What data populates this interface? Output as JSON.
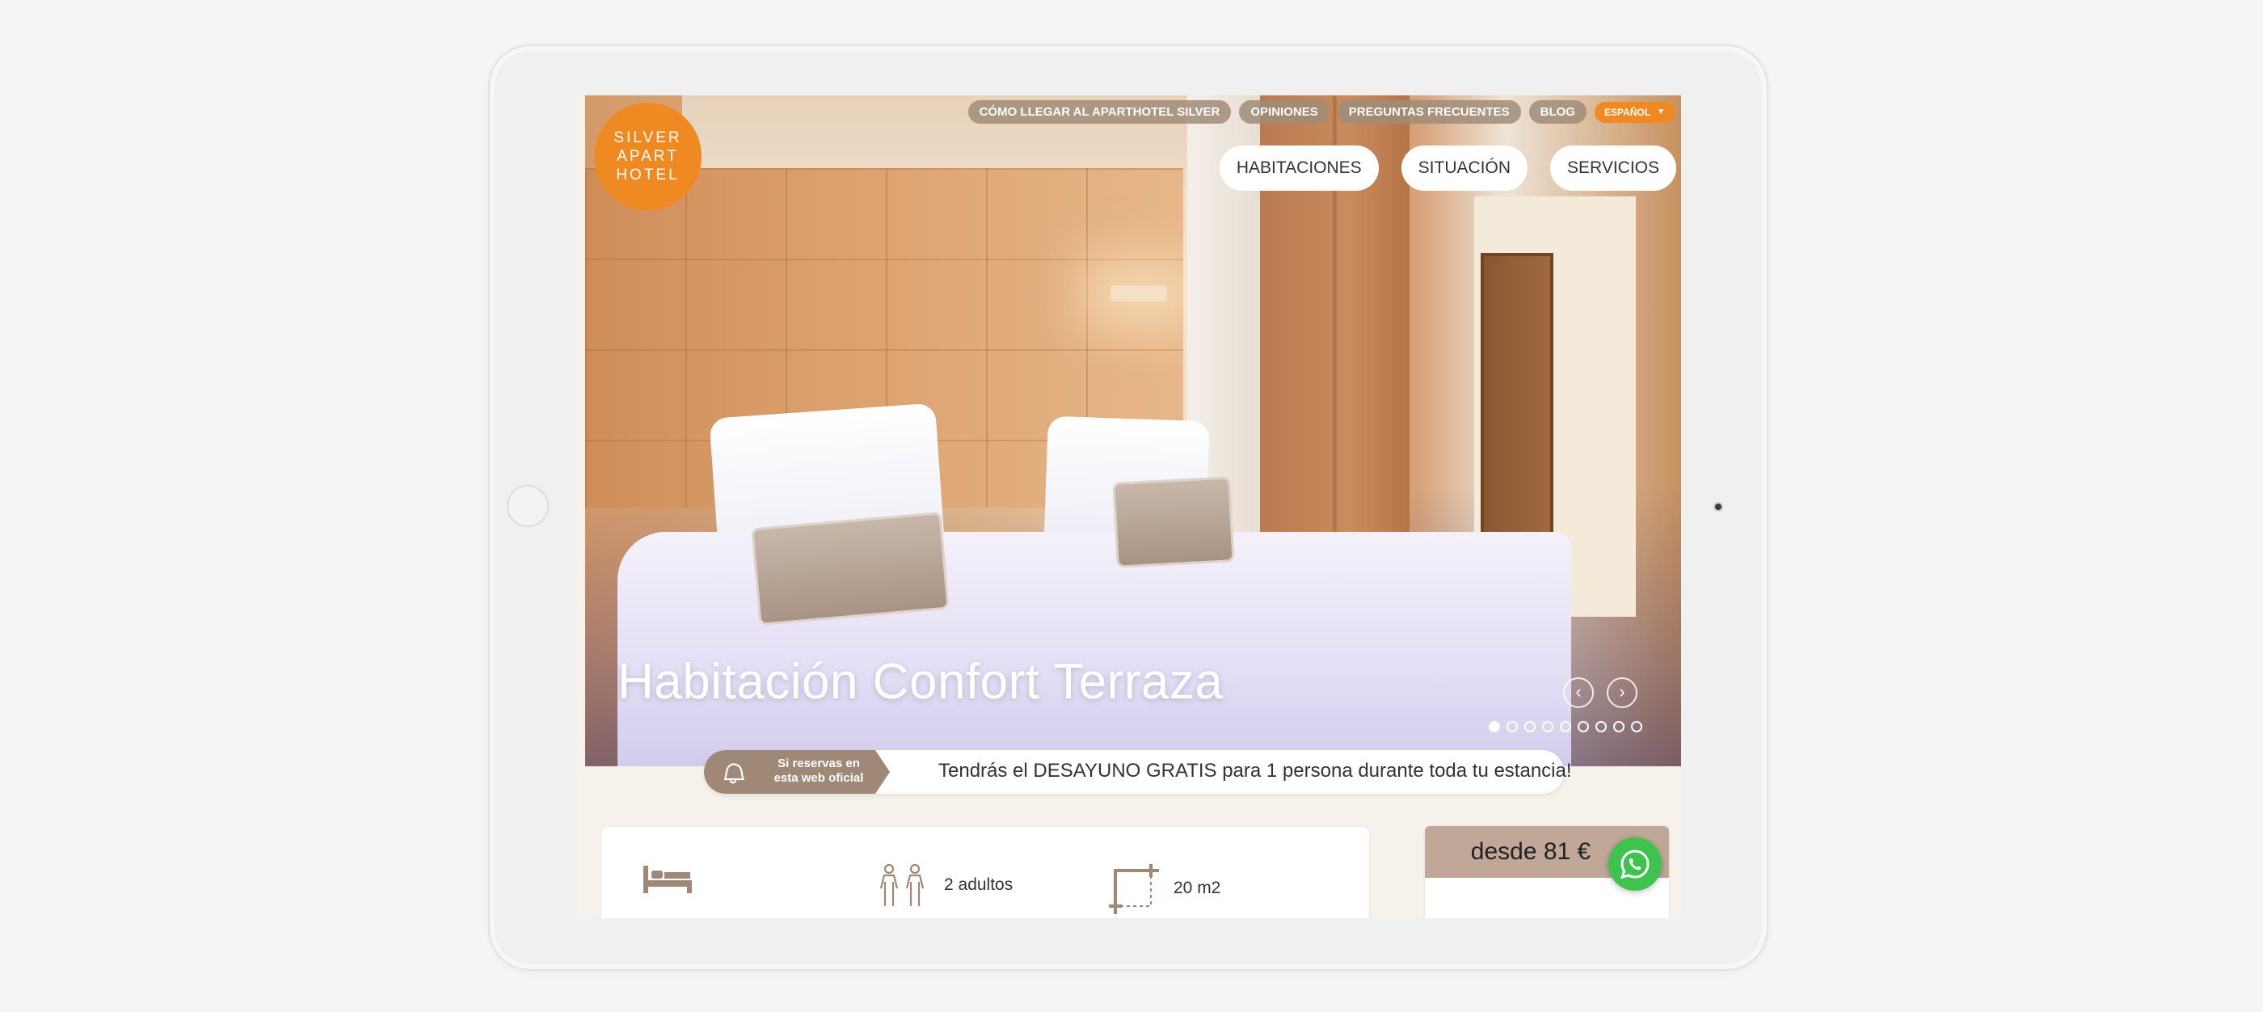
{
  "logo": {
    "line1": "SILVER",
    "line2": "APART",
    "line3": "HOTEL"
  },
  "topbar": {
    "links": [
      "CÓMO LLEGAR AL APARTHOTEL SILVER",
      "OPINIONES",
      "PREGUNTAS FRECUENTES",
      "BLOG"
    ],
    "language": "ESPAÑOL"
  },
  "nav": {
    "items": [
      "HABITACIONES",
      "SITUACIÓN",
      "SERVICIOS"
    ]
  },
  "hero": {
    "title": "Habitación Confort Terraza",
    "slide_count": 9,
    "active_slide": 1
  },
  "promo": {
    "tag_line1": "Si reservas en",
    "tag_line2": "esta web oficial",
    "message": "Tendrás el DESAYUNO GRATIS para 1 persona durante toda tu estancia!"
  },
  "features": {
    "guests": "2 adultos",
    "size": "20 m2"
  },
  "price": {
    "label": "desde 81 €"
  },
  "colors": {
    "accent_orange": "#ef8a22",
    "taupe": "#a08877",
    "whatsapp_green": "#3ec34f"
  },
  "icons": {
    "bed": "bed-icon",
    "guests": "two-people-icon",
    "size": "floor-plan-icon",
    "promo": "bell-icon",
    "chat": "whatsapp-icon"
  }
}
